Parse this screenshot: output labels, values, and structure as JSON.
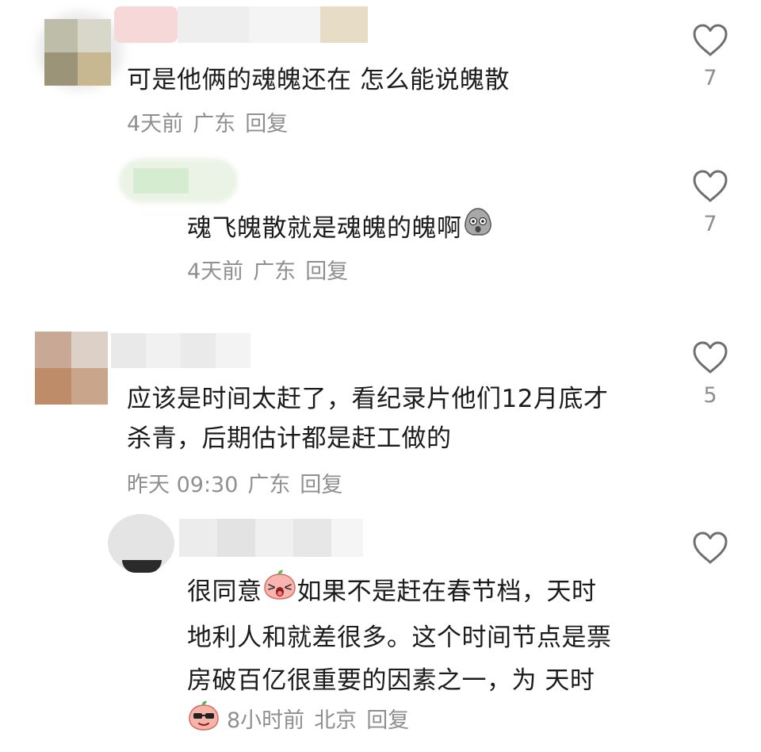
{
  "colors": {
    "text": "#1b1b1b",
    "meta": "#8f8f8f",
    "icon": "#6f6f6f"
  },
  "comments": [
    {
      "text": "可是他俩的魂魄还在 怎么能说魄散",
      "time": "4天前",
      "location": "广东",
      "reply": "回复",
      "likes": "7"
    },
    {
      "text": "魂飞魄散就是魂魄的魄啊",
      "emoji": "ghost-emoji",
      "time": "4天前",
      "location": "广东",
      "reply": "回复",
      "likes": "7"
    },
    {
      "line1": "应该是时间太赶了，看纪录片他们12月底才",
      "line2": "杀青，后期估计都是赶工做的",
      "time": "昨天 09:30",
      "location": "广东",
      "reply": "回复",
      "likes": "5"
    },
    {
      "line1_a": "很同意",
      "emoji": "peach-shocked-emoji",
      "line1_b": "如果不是赶在春节档，天时",
      "line2": "地利人和就差很多。这个时间节点是票",
      "line3": "房破百亿很重要的因素之一，为 天时",
      "sticker": "peach-sunglasses-sticker",
      "time": "8小时前",
      "location": "北京",
      "reply": "回复"
    }
  ]
}
